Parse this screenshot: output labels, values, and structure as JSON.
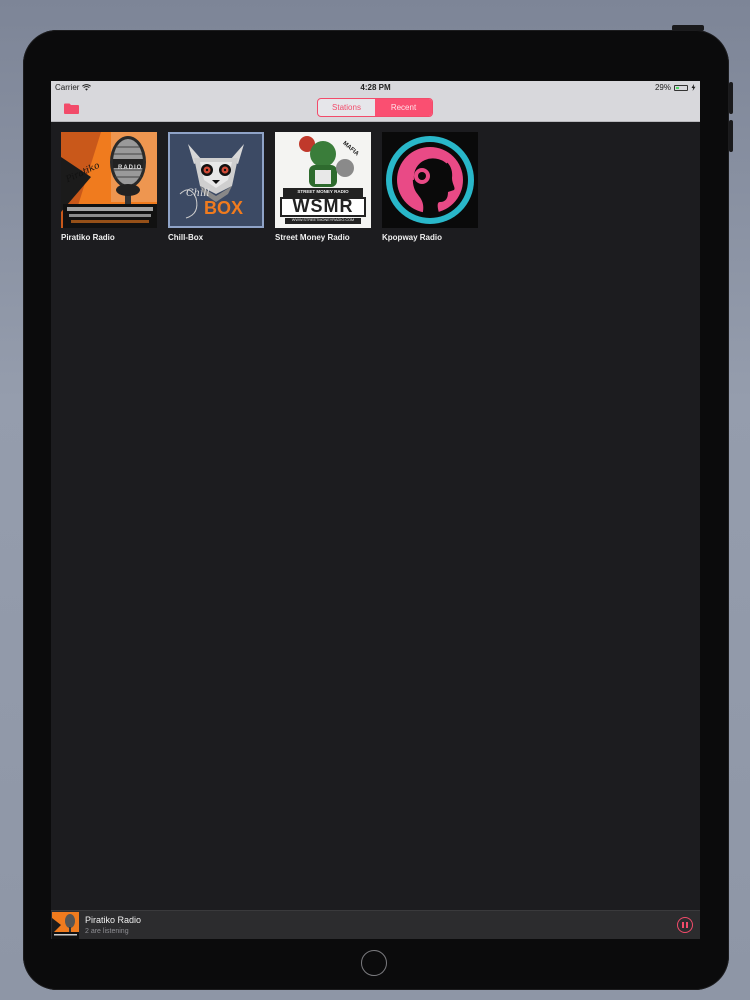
{
  "status_bar": {
    "carrier": "Carrier",
    "time": "4:28 PM",
    "battery_percent": "29%",
    "battery_level": 0.29
  },
  "nav": {
    "segments": [
      {
        "label": "Stations",
        "selected": false
      },
      {
        "label": "Recent",
        "selected": true
      }
    ],
    "left_icon": "folder-icon"
  },
  "stations": [
    {
      "name": "Piratiko Radio",
      "logo_text": [
        "Piratiko",
        "RADIO"
      ]
    },
    {
      "name": "Chill-Box",
      "logo_text": [
        "Chill",
        "BOX"
      ]
    },
    {
      "name": "Street Money Radio",
      "logo_text": [
        "WSMR",
        "MAFIA",
        "STREET MONEY RADIO",
        "WWW.STREETMONEYRADIO.COM"
      ]
    },
    {
      "name": "Kpopway Radio",
      "logo_text": []
    }
  ],
  "now_playing": {
    "title": "Piratiko Radio",
    "subtitle": "2 are listening",
    "control_icon": "pause-icon"
  },
  "colors": {
    "accent": "#f24b6a",
    "segment_active": "#fa4f71",
    "background": "#1c1c1f",
    "bar": "#d8d8dc"
  }
}
